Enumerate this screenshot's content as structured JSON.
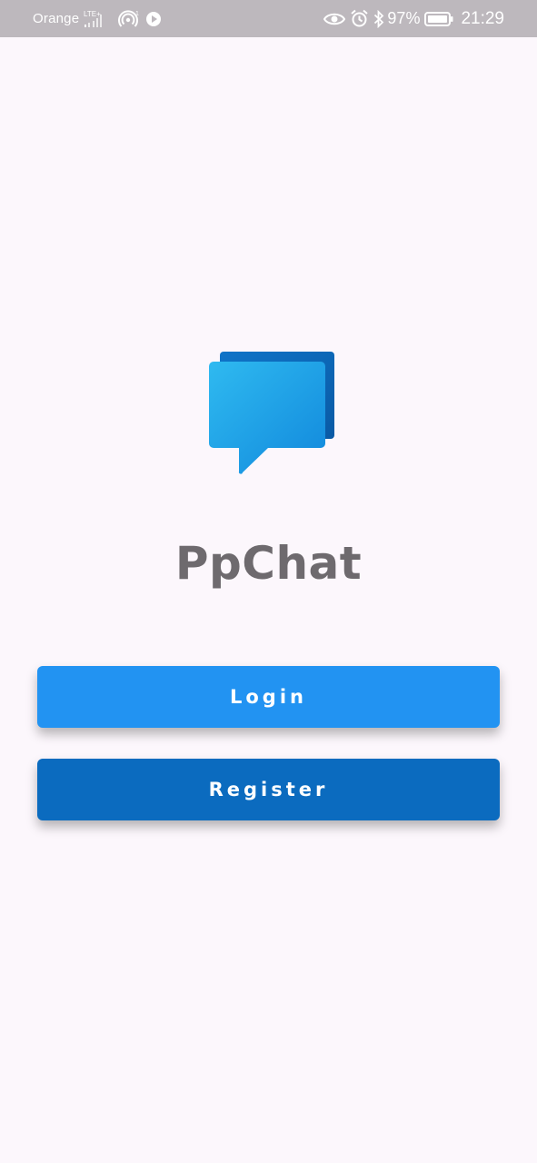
{
  "status_bar": {
    "carrier": "Orange",
    "network_label": "LTE",
    "battery_percent": "97%",
    "time": "21:29",
    "icons": [
      "signal-icon",
      "hotspot-icon",
      "media-play-icon",
      "eye-icon",
      "alarm-icon",
      "bluetooth-icon",
      "battery-icon"
    ]
  },
  "app": {
    "title": "PpChat",
    "logo_icon": "chat-bubbles-icon"
  },
  "buttons": {
    "login_label": "Login",
    "register_label": "Register"
  },
  "colors": {
    "background": "#fcf7fc",
    "status_bar": "#bdb8bd",
    "title_text": "#6e6a6e",
    "login_button": "#2293f2",
    "register_button": "#0b6bbf",
    "logo_front": "#2ea6ec",
    "logo_back": "#0d65b5"
  }
}
